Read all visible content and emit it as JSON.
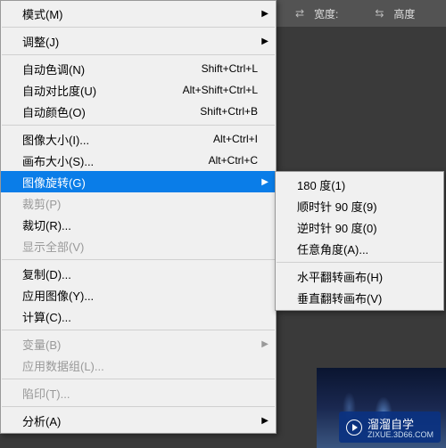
{
  "toolbar": {
    "width_label": "宽度:",
    "height_label": "高度"
  },
  "menu": {
    "items": [
      {
        "label": "模式(M)",
        "arrow": true
      },
      {
        "sep": true
      },
      {
        "label": "调整(J)",
        "arrow": true
      },
      {
        "sep": true
      },
      {
        "label": "自动色调(N)",
        "shortcut": "Shift+Ctrl+L"
      },
      {
        "label": "自动对比度(U)",
        "shortcut": "Alt+Shift+Ctrl+L"
      },
      {
        "label": "自动颜色(O)",
        "shortcut": "Shift+Ctrl+B"
      },
      {
        "sep": true
      },
      {
        "label": "图像大小(I)...",
        "shortcut": "Alt+Ctrl+I"
      },
      {
        "label": "画布大小(S)...",
        "shortcut": "Alt+Ctrl+C"
      },
      {
        "label": "图像旋转(G)",
        "arrow": true,
        "hl": true
      },
      {
        "label": "裁剪(P)",
        "disabled": true
      },
      {
        "label": "裁切(R)..."
      },
      {
        "label": "显示全部(V)",
        "disabled": true
      },
      {
        "sep": true
      },
      {
        "label": "复制(D)..."
      },
      {
        "label": "应用图像(Y)..."
      },
      {
        "label": "计算(C)..."
      },
      {
        "sep": true
      },
      {
        "label": "变量(B)",
        "arrow": true,
        "disabled": true
      },
      {
        "label": "应用数据组(L)...",
        "disabled": true
      },
      {
        "sep": true
      },
      {
        "label": "陷印(T)...",
        "disabled": true
      },
      {
        "sep": true
      },
      {
        "label": "分析(A)",
        "arrow": true
      }
    ]
  },
  "submenu": {
    "items": [
      {
        "label": "180 度(1)"
      },
      {
        "label": "顺时针 90 度(9)"
      },
      {
        "label": "逆时针 90 度(0)"
      },
      {
        "label": "任意角度(A)..."
      },
      {
        "sep": true
      },
      {
        "label": "水平翻转画布(H)"
      },
      {
        "label": "垂直翻转画布(V)"
      }
    ]
  },
  "watermark": {
    "main": "溜溜自学",
    "sub": "ZIXUE.3D66.COM"
  }
}
